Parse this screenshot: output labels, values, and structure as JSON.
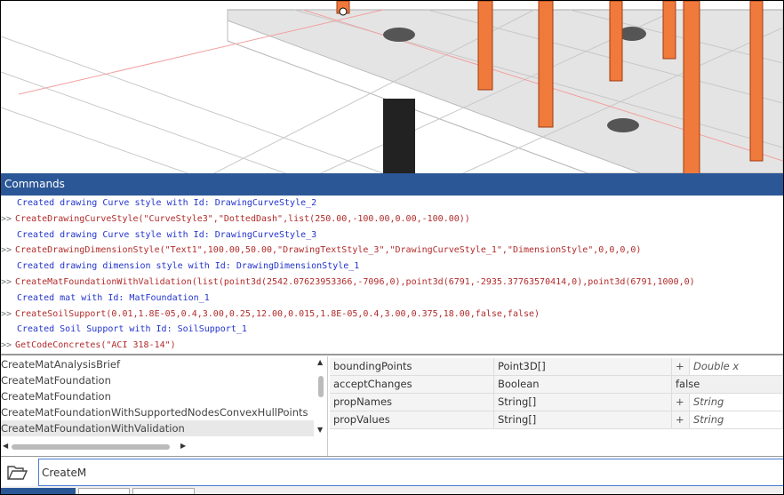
{
  "commands_panel": {
    "title": "Commands"
  },
  "log": [
    {
      "type": "out",
      "text": "Created drawing Curve style with Id: DrawingCurveStyle_2"
    },
    {
      "type": "cmd",
      "text": "CreateDrawingCurveStyle(\"CurveStyle3\",\"DottedDash\",list(250.00,-100.00,0.00,-100.00))"
    },
    {
      "type": "out",
      "text": "Created drawing Curve style with Id: DrawingCurveStyle_3"
    },
    {
      "type": "cmd",
      "text": "CreateDrawingDimensionStyle(\"Text1\",100.00,50.00,\"DrawingTextStyle_3\",\"DrawingCurveStyle_1\",\"DimensionStyle\",0,0,0,0)"
    },
    {
      "type": "out",
      "text": "Created drawing dimension style with Id: DrawingDimensionStyle_1"
    },
    {
      "type": "cmd",
      "text": "CreateMatFoundationWithValidation(list(point3d(2542.07623953366,-7096,0),point3d(6791,-2935.37763570414,0),point3d(6791,1000,0)"
    },
    {
      "type": "out",
      "text": "Created mat with Id: MatFoundation_1"
    },
    {
      "type": "cmd",
      "text": "CreateSoilSupport(0.01,1.8E-05,0.4,3.00,0.25,12.00,0.015,1.8E-05,0.4,3.00,0.375,18.00,false,false)"
    },
    {
      "type": "out",
      "text": "Created Soil Support with Id: SoilSupport_1"
    },
    {
      "type": "cmd",
      "text": "GetCodeConcretes(\"ACI 318-14\")"
    }
  ],
  "prompt": ">>",
  "suggestions": [
    "CreateMatAnalysisBrief",
    "CreateMatFoundation",
    "CreateMatFoundation",
    "CreateMatFoundationWithSupportedNodesConvexHullPoints",
    "CreateMatFoundationWithValidation"
  ],
  "selected_suggestion": 4,
  "params": [
    {
      "name": "boundingPoints",
      "type": "Point3D[]",
      "plus": "+",
      "value": "Double x"
    },
    {
      "name": "acceptChanges",
      "type": "Boolean",
      "value": "false"
    },
    {
      "name": "propNames",
      "type": "String[]",
      "plus": "+",
      "value": "String"
    },
    {
      "name": "propValues",
      "type": "String[]",
      "plus": "+",
      "value": "String"
    }
  ],
  "command_input": {
    "value": "CreateM"
  },
  "colors": {
    "header": "#2b5797",
    "output": "#2233cc",
    "command": "#b22a2a",
    "steel": "#f07a3c"
  }
}
